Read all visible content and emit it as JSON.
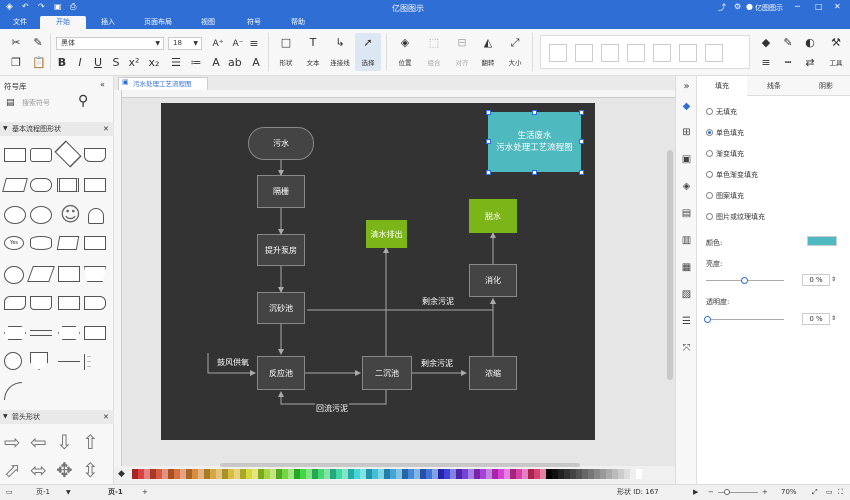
{
  "app": {
    "title": "亿图图示"
  },
  "titlebar": {
    "user": "亿图图示"
  },
  "menu": {
    "tabs": [
      "文件",
      "开始",
      "插入",
      "页面布局",
      "视图",
      "符号",
      "帮助"
    ],
    "active": "开始"
  },
  "ribbon": {
    "font_name": "黑体",
    "font_size": "18",
    "buttons": [
      "形状",
      "文本",
      "连接线",
      "选择",
      "位置",
      "组合",
      "对齐",
      "翻转",
      "大小",
      "工具"
    ]
  },
  "left_panel": {
    "title": "符号库",
    "search_placeholder": "搜索符号",
    "sections": [
      "基本流程图形状",
      "箭头形状"
    ]
  },
  "document": {
    "tab_title": "污水处理工艺流程图"
  },
  "diagram": {
    "title_lines": [
      "生活废水",
      "污水处理工艺流程图"
    ],
    "nodes": {
      "sewage": "污水",
      "grille": "隔栅",
      "pump": "提升泵房",
      "grit": "沉砂池",
      "reactor": "反应池",
      "secondary": "二沉池",
      "thicken": "浓缩",
      "digest": "消化",
      "dewater": "脱水",
      "clean_discharge": "清水排出"
    },
    "edge_labels": {
      "blower": "鼓风供氧",
      "return_sludge": "回流污泥",
      "excess1": "剩余污泥",
      "excess2": "剩余污泥"
    }
  },
  "right_panel": {
    "tabs": [
      "填充",
      "线条",
      "阴影"
    ],
    "fill_options": [
      "无填充",
      "单色填充",
      "渐变填充",
      "单色渐变填充",
      "图案填充",
      "图片或纹理填充"
    ],
    "selected_fill": "单色填充",
    "color_label": "颜色:",
    "color_value": "#4fb9c0",
    "brightness_label": "亮度:",
    "brightness_value": "0 %",
    "transparency_label": "透明度:",
    "transparency_value": "0 %"
  },
  "status": {
    "page_label": "页-1",
    "page_tab": "页-1",
    "shape_id": "形状 ID: 167",
    "zoom": "70%"
  }
}
